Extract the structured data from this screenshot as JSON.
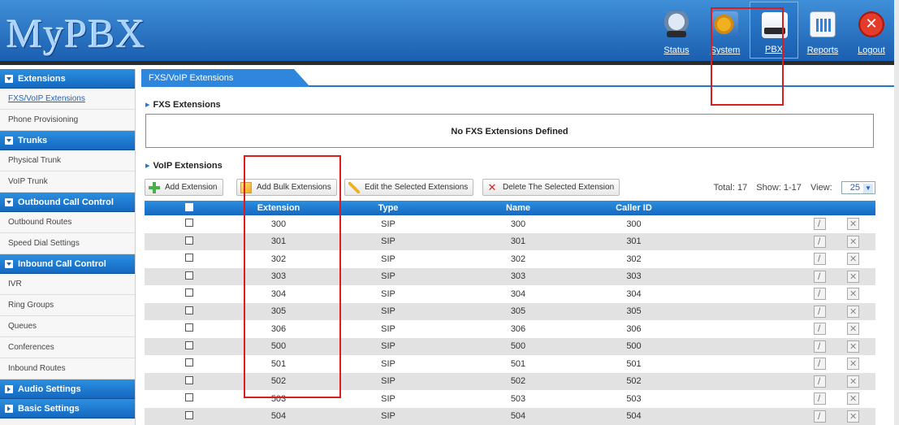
{
  "header": {
    "logo": "MyPBX",
    "nav": [
      {
        "label": "Status",
        "icon": "status-icon"
      },
      {
        "label": "System",
        "icon": "system-icon"
      },
      {
        "label": "PBX",
        "icon": "pbx-icon",
        "active": true
      },
      {
        "label": "Reports",
        "icon": "reports-icon"
      },
      {
        "label": "Logout",
        "icon": "logout-icon"
      }
    ]
  },
  "sidebar": {
    "sections": [
      {
        "title": "Extensions",
        "items": [
          "FXS/VoIP Extensions",
          "Phone Provisioning"
        ]
      },
      {
        "title": "Trunks",
        "items": [
          "Physical Trunk",
          "VoIP Trunk"
        ]
      },
      {
        "title": "Outbound Call Control",
        "items": [
          "Outbound Routes",
          "Speed Dial Settings"
        ]
      },
      {
        "title": "Inbound Call Control",
        "items": [
          "IVR",
          "Ring Groups",
          "Queues",
          "Conferences",
          "Inbound Routes"
        ]
      },
      {
        "title": "Audio Settings",
        "items": []
      },
      {
        "title": "Basic Settings",
        "items": []
      }
    ],
    "active_item": "FXS/VoIP Extensions"
  },
  "main": {
    "tab": "FXS/VoIP Extensions",
    "fxs_title": "FXS Extensions",
    "fxs_empty": "No FXS Extensions Defined",
    "voip_title": "VoIP Extensions",
    "toolbar": {
      "add": "Add Extension",
      "bulk": "Add Bulk Extensions",
      "edit": "Edit the Selected Extensions",
      "delete": "Delete The Selected Extension"
    },
    "totals": {
      "total": "Total: 17",
      "show": "Show: 1-17",
      "view_label": "View:",
      "view_value": "25"
    },
    "columns": [
      "Extension",
      "Type",
      "Name",
      "Caller ID"
    ],
    "rows": [
      {
        "ext": "300",
        "type": "SIP",
        "name": "300",
        "cid": "300"
      },
      {
        "ext": "301",
        "type": "SIP",
        "name": "301",
        "cid": "301"
      },
      {
        "ext": "302",
        "type": "SIP",
        "name": "302",
        "cid": "302"
      },
      {
        "ext": "303",
        "type": "SIP",
        "name": "303",
        "cid": "303"
      },
      {
        "ext": "304",
        "type": "SIP",
        "name": "304",
        "cid": "304"
      },
      {
        "ext": "305",
        "type": "SIP",
        "name": "305",
        "cid": "305"
      },
      {
        "ext": "306",
        "type": "SIP",
        "name": "306",
        "cid": "306"
      },
      {
        "ext": "500",
        "type": "SIP",
        "name": "500",
        "cid": "500"
      },
      {
        "ext": "501",
        "type": "SIP",
        "name": "501",
        "cid": "501"
      },
      {
        "ext": "502",
        "type": "SIP",
        "name": "502",
        "cid": "502"
      },
      {
        "ext": "503",
        "type": "SIP",
        "name": "503",
        "cid": "503"
      },
      {
        "ext": "504",
        "type": "SIP",
        "name": "504",
        "cid": "504"
      }
    ]
  },
  "colors": {
    "accent": "#1f77d0",
    "annotation": "#d81e1e"
  }
}
